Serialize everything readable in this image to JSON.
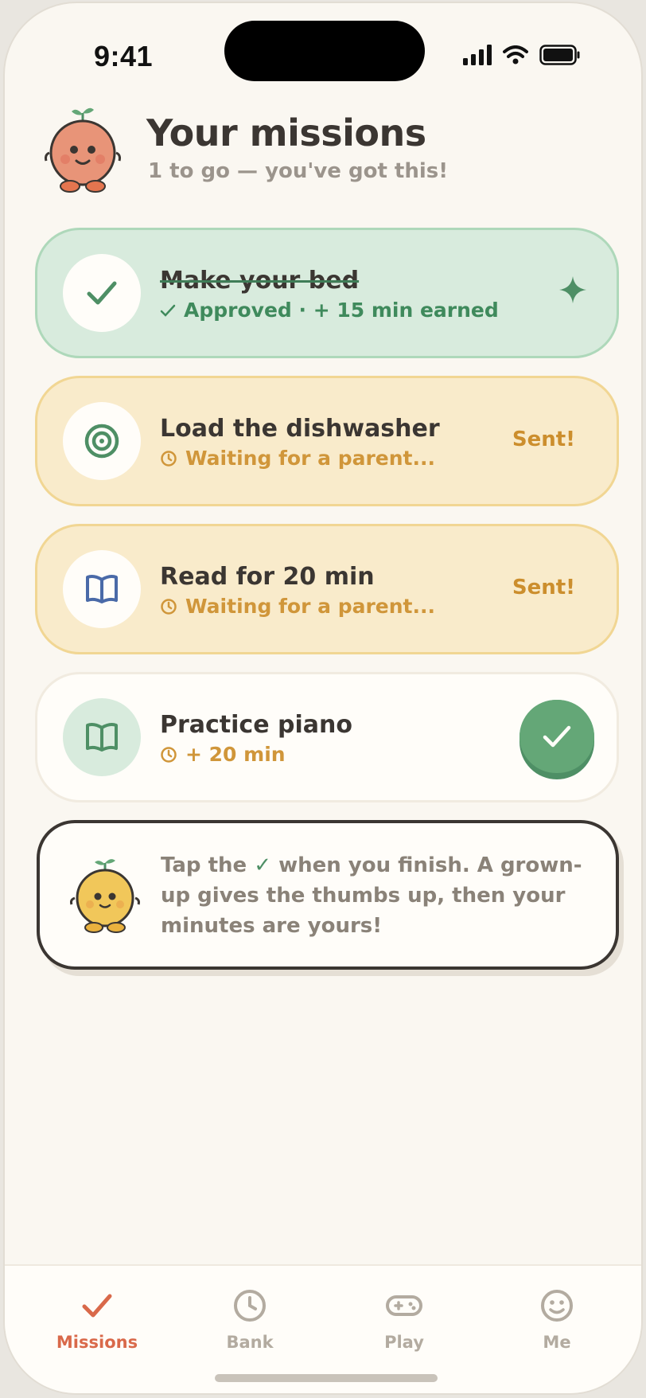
{
  "status_bar": {
    "time": "9:41"
  },
  "header": {
    "title": "Your missions",
    "subtitle": "1 to go — you've got this!"
  },
  "missions": [
    {
      "title": "Make your bed",
      "status": "approved",
      "detail": "Approved · + 15 min earned",
      "icon": "check-icon"
    },
    {
      "title": "Load the dishwasher",
      "status": "sent",
      "detail": "Waiting for a parent...",
      "badge": "Sent!",
      "icon": "target-icon"
    },
    {
      "title": "Read for 20 min",
      "status": "sent",
      "detail": "Waiting for a parent...",
      "badge": "Sent!",
      "icon": "book-icon"
    },
    {
      "title": "Practice piano",
      "status": "todo",
      "detail": "+ 20 min",
      "icon": "book-icon"
    }
  ],
  "hint": {
    "before_check": "Tap the ",
    "check_glyph": "✓",
    "after_check": " when you finish. A grown-up gives the thumbs up, then your minutes are yours!"
  },
  "tabs": [
    {
      "label": "Missions",
      "icon": "check-icon",
      "active": true
    },
    {
      "label": "Bank",
      "icon": "clock-icon",
      "active": false
    },
    {
      "label": "Play",
      "icon": "gamepad-icon",
      "active": false
    },
    {
      "label": "Me",
      "icon": "smiley-icon",
      "active": false
    }
  ],
  "colors": {
    "approved_bg": "#d8ebdd",
    "pending_bg": "#f9ebcb",
    "accent_green": "#64a777",
    "accent_orange": "#d9694a",
    "pending_text": "#cc8e2d"
  }
}
